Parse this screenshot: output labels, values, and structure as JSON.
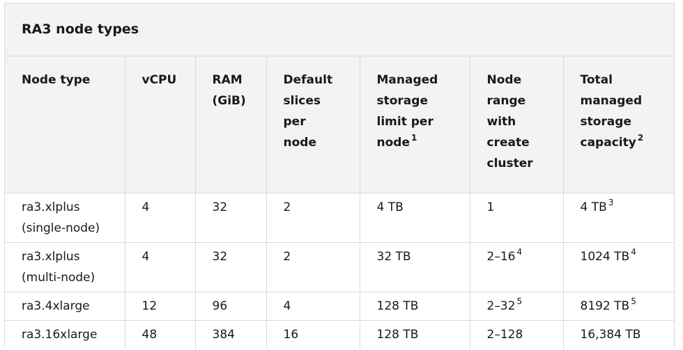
{
  "title": "RA3 node types",
  "headers": [
    {
      "label": "Node type",
      "sup": ""
    },
    {
      "label": "vCPU",
      "sup": ""
    },
    {
      "label": "RAM (GiB)",
      "sup": ""
    },
    {
      "label": "Default slices per node",
      "sup": ""
    },
    {
      "label": "Managed storage limit per node",
      "sup": "1"
    },
    {
      "label": "Node range with create cluster",
      "sup": ""
    },
    {
      "label": "Total managed storage capacity",
      "sup": "2"
    }
  ],
  "rows": [
    [
      {
        "text": "ra3.xlplus (single-node)",
        "sup": ""
      },
      {
        "text": "4",
        "sup": ""
      },
      {
        "text": "32",
        "sup": ""
      },
      {
        "text": "2",
        "sup": ""
      },
      {
        "text": "4 TB",
        "sup": ""
      },
      {
        "text": "1",
        "sup": ""
      },
      {
        "text": "4 TB",
        "sup": "3"
      }
    ],
    [
      {
        "text": "ra3.xlplus (multi-node)",
        "sup": ""
      },
      {
        "text": "4",
        "sup": ""
      },
      {
        "text": "32",
        "sup": ""
      },
      {
        "text": "2",
        "sup": ""
      },
      {
        "text": "32 TB",
        "sup": ""
      },
      {
        "text": "2–16",
        "sup": "4"
      },
      {
        "text": "1024 TB",
        "sup": "4"
      }
    ],
    [
      {
        "text": "ra3.4xlarge",
        "sup": ""
      },
      {
        "text": "12",
        "sup": ""
      },
      {
        "text": "96",
        "sup": ""
      },
      {
        "text": "4",
        "sup": ""
      },
      {
        "text": "128 TB",
        "sup": ""
      },
      {
        "text": "2–32",
        "sup": "5"
      },
      {
        "text": "8192 TB",
        "sup": "5"
      }
    ],
    [
      {
        "text": "ra3.16xlarge",
        "sup": ""
      },
      {
        "text": "48",
        "sup": ""
      },
      {
        "text": "384",
        "sup": ""
      },
      {
        "text": "16",
        "sup": ""
      },
      {
        "text": "128 TB",
        "sup": ""
      },
      {
        "text": "2–128",
        "sup": ""
      },
      {
        "text": "16,384 TB",
        "sup": ""
      }
    ]
  ]
}
